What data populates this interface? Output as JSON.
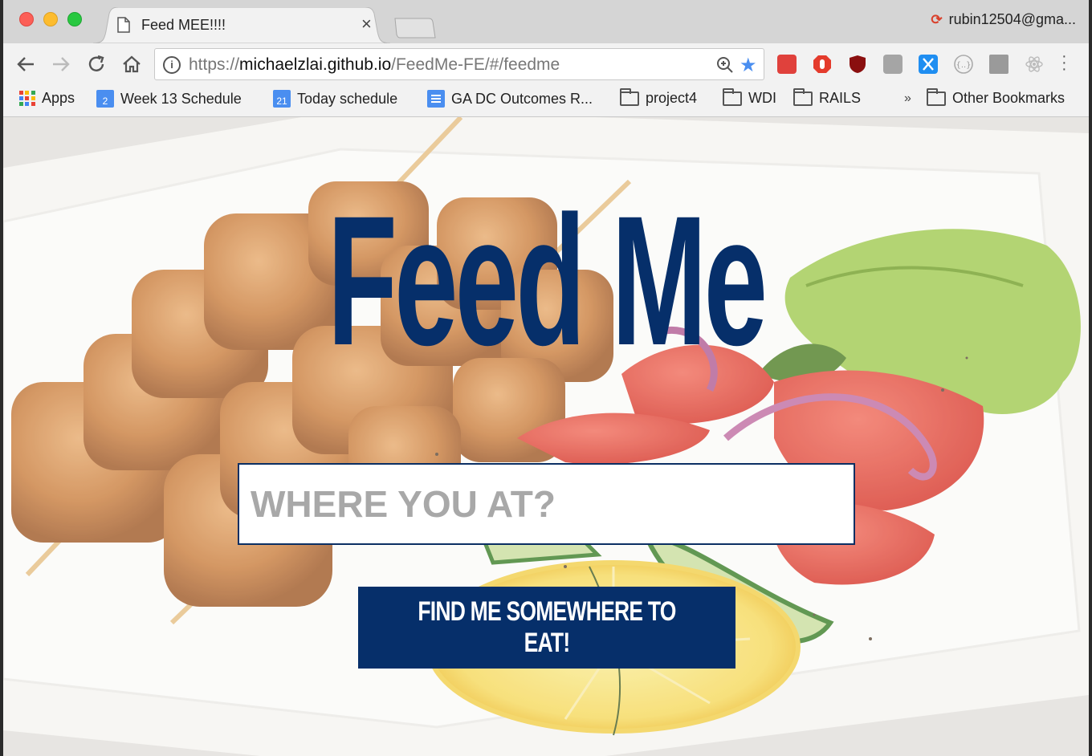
{
  "browser": {
    "tab": {
      "title": "Feed MEE!!!!",
      "close": "×"
    },
    "profile": {
      "name": "rubin12504@gma...",
      "icon": "sync-error-icon"
    },
    "url": {
      "scheme": "https://",
      "host": "michaelzlai.github.io",
      "path": "/FeedMe-FE/#/feedme"
    },
    "bookmarks": [
      {
        "label": "Apps",
        "icon": "apps-grid-icon"
      },
      {
        "label": "Week 13 Schedule",
        "icon": "calendar-icon",
        "badge": "2"
      },
      {
        "label": "Today schedule",
        "icon": "calendar-icon",
        "badge": "21"
      },
      {
        "label": "GA DC Outcomes R...",
        "icon": "docs-icon"
      },
      {
        "label": "project4",
        "icon": "folder-icon"
      },
      {
        "label": "WDI",
        "icon": "folder-icon"
      },
      {
        "label": "RAILS",
        "icon": "folder-icon"
      }
    ],
    "overflow": "»",
    "other_bookmarks": "Other Bookmarks"
  },
  "page": {
    "title": "Feed Me",
    "search": {
      "placeholder": "WHERE YOU AT?",
      "value": ""
    },
    "button": "FIND ME SOMEWHERE TO EAT!"
  },
  "colors": {
    "brand_navy": "#062f6a",
    "placeholder": "#a8a8a8",
    "accent_blue": "#4a8ef0"
  }
}
